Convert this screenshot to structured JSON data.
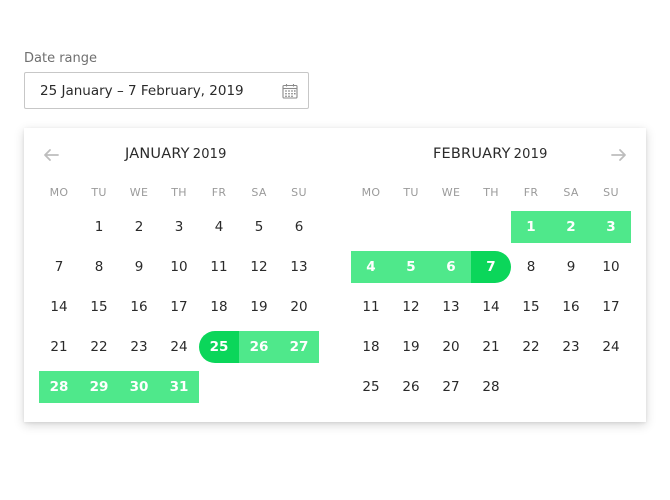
{
  "field": {
    "label": "Date range",
    "value": "25 January – 7 February, 2019",
    "icon": "calendar-icon"
  },
  "nav": {
    "prev_icon": "arrow-left-icon",
    "next_icon": "arrow-right-icon"
  },
  "colors": {
    "range": "#4fe88b",
    "endpoint": "#0bd65a",
    "muted": "#9a9a9a"
  },
  "calendars": [
    {
      "month": "JANUARY",
      "year": "2019",
      "weekdays": [
        "MO",
        "TU",
        "WE",
        "TH",
        "FR",
        "SA",
        "SU"
      ],
      "first_weekday_index": 1,
      "days": 31
    },
    {
      "month": "FEBRUARY",
      "year": "2019",
      "weekdays": [
        "MO",
        "TU",
        "WE",
        "TH",
        "FR",
        "SA",
        "SU"
      ],
      "first_weekday_index": 4,
      "days": 28
    }
  ],
  "selection": {
    "start": {
      "calendar": 0,
      "day": 25
    },
    "end": {
      "calendar": 1,
      "day": 7
    }
  }
}
